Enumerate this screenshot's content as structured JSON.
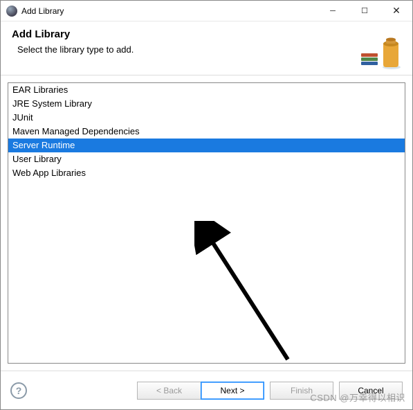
{
  "titlebar": {
    "title": "Add Library"
  },
  "header": {
    "heading": "Add Library",
    "subheading": "Select the library type to add."
  },
  "list": {
    "items": [
      {
        "label": "EAR Libraries",
        "selected": false
      },
      {
        "label": "JRE System Library",
        "selected": false
      },
      {
        "label": "JUnit",
        "selected": false
      },
      {
        "label": "Maven Managed Dependencies",
        "selected": false
      },
      {
        "label": "Server Runtime",
        "selected": true
      },
      {
        "label": "User Library",
        "selected": false
      },
      {
        "label": "Web App Libraries",
        "selected": false
      }
    ]
  },
  "buttons": {
    "back": "< Back",
    "next": "Next >",
    "finish": "Finish",
    "cancel": "Cancel"
  },
  "watermark": "CSDN @万幸得以相识"
}
